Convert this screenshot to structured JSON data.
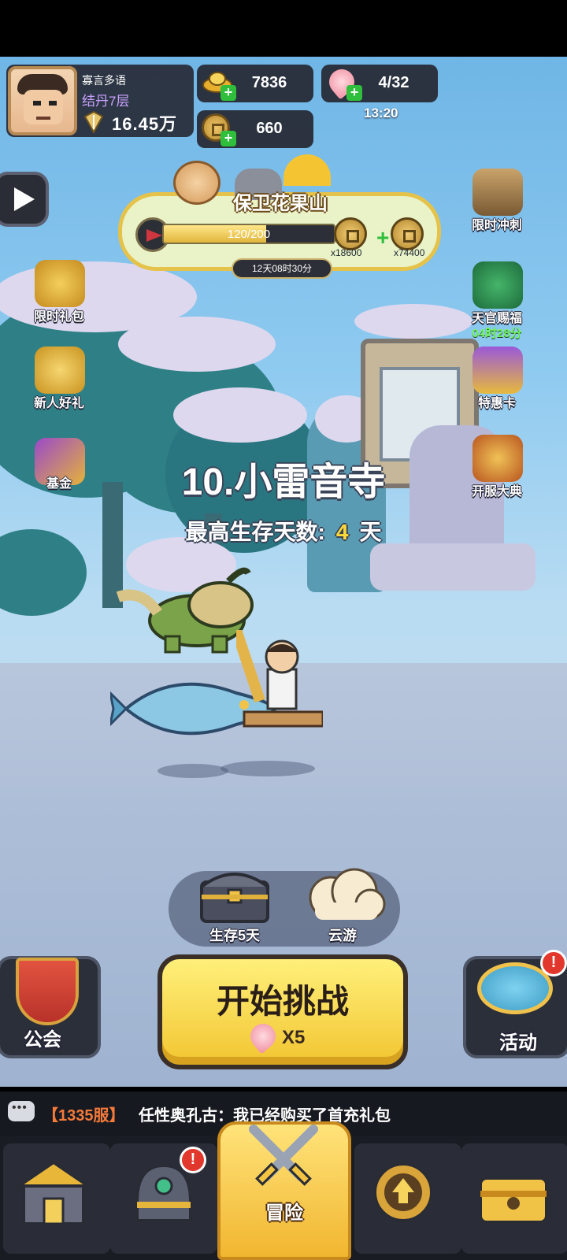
{
  "player": {
    "name": "寡言多语",
    "realm": "结丹7层",
    "power": "16.45万"
  },
  "resources": {
    "gold_ingot": "7836",
    "coins": "660",
    "stamina": "4/32",
    "stamina_timer": "13:20"
  },
  "event": {
    "title": "保卫花果山",
    "progress_text": "120/200",
    "progress_fraction": 0.6,
    "reward_1_qty": "x18600",
    "reward_2_qty": "x74400",
    "countdown": "12天08时30分"
  },
  "left_menu": [
    {
      "label": "限时礼包",
      "icon": "gift-bag-icon"
    },
    {
      "label": "新人好礼",
      "icon": "gold-ingot-gift-icon"
    },
    {
      "label": "基金",
      "icon": "fund-chart-icon"
    }
  ],
  "right_menu": [
    {
      "label": "限时冲刺",
      "icon": "hourglass-icon"
    },
    {
      "label": "天官赐福",
      "icon": "fan-icon",
      "timer": "04时28分"
    },
    {
      "label": "特惠卡",
      "icon": "vip-card-icon"
    },
    {
      "label": "开服大典",
      "icon": "drum-icon"
    }
  ],
  "stage": {
    "name": "10.小雷音寺",
    "survival_label": "最高生存天数:",
    "survival_days": "4",
    "survival_unit": "天"
  },
  "scene_buttons": {
    "chest_label": "生存5天",
    "cloud_label": "云游"
  },
  "actions": {
    "guild_label": "公会",
    "start_label": "开始挑战",
    "start_cost": "X5",
    "activity_label": "活动",
    "badge": "!"
  },
  "chat": {
    "server": "【1335服】",
    "message": "任性奥孔古：我已经购买了首充礼包"
  },
  "nav": {
    "active_label": "冒险",
    "items": [
      "shop-icon",
      "equipment-helmet-icon",
      "crossed-swords-icon",
      "upgrade-arrow-icon",
      "treasure-chest-icon"
    ]
  },
  "colors": {
    "accent_yellow": "#f2c531",
    "scene_sky": "#8fcaf0",
    "stamina_green": "#6ff55c",
    "badge_red": "#e2372c"
  }
}
